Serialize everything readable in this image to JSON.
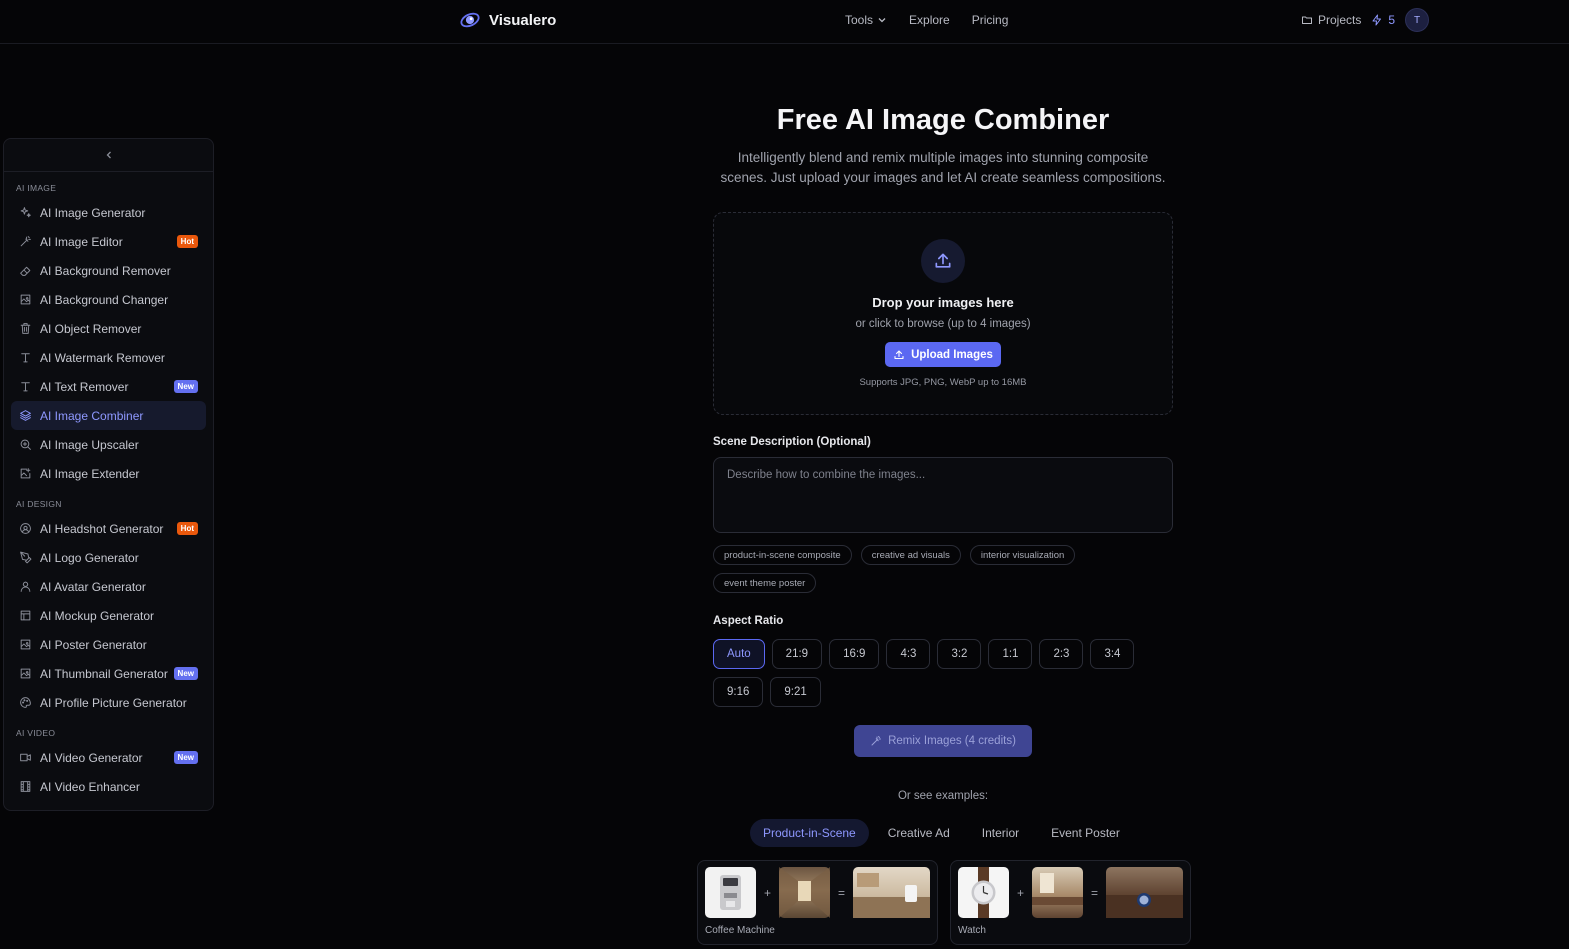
{
  "header": {
    "brand": "Visualero",
    "nav": [
      {
        "label": "Tools",
        "has_dropdown": true
      },
      {
        "label": "Explore"
      },
      {
        "label": "Pricing"
      }
    ],
    "projects_label": "Projects",
    "credits": "5",
    "avatar_initial": "T"
  },
  "sidebar": {
    "sections": [
      {
        "label": "AI IMAGE",
        "items": [
          {
            "label": "AI Image Generator",
            "icon": "sparkles-icon"
          },
          {
            "label": "AI Image Editor",
            "icon": "magic-wand-icon",
            "badge": "Hot"
          },
          {
            "label": "AI Background Remover",
            "icon": "eraser-icon"
          },
          {
            "label": "AI Background Changer",
            "icon": "image-icon"
          },
          {
            "label": "AI Object Remover",
            "icon": "trash-icon"
          },
          {
            "label": "AI Watermark Remover",
            "icon": "text-icon"
          },
          {
            "label": "AI Text Remover",
            "icon": "text-icon",
            "badge": "New"
          },
          {
            "label": "AI Image Combiner",
            "icon": "layers-icon",
            "active": true
          },
          {
            "label": "AI Image Upscaler",
            "icon": "zoom-in-icon"
          },
          {
            "label": "AI Image Extender",
            "icon": "image-plus-icon"
          }
        ]
      },
      {
        "label": "AI DESIGN",
        "items": [
          {
            "label": "AI Headshot Generator",
            "icon": "user-circle-icon",
            "badge": "Hot"
          },
          {
            "label": "AI Logo Generator",
            "icon": "pen-tool-icon"
          },
          {
            "label": "AI Avatar Generator",
            "icon": "user-icon"
          },
          {
            "label": "AI Mockup Generator",
            "icon": "layout-icon"
          },
          {
            "label": "AI Poster Generator",
            "icon": "image-icon"
          },
          {
            "label": "AI Thumbnail Generator",
            "icon": "image-icon",
            "badge": "New"
          },
          {
            "label": "AI Profile Picture Generator",
            "icon": "palette-icon"
          }
        ]
      },
      {
        "label": "AI VIDEO",
        "items": [
          {
            "label": "AI Video Generator",
            "icon": "video-icon",
            "badge": "New"
          },
          {
            "label": "AI Video Enhancer",
            "icon": "film-icon"
          }
        ]
      }
    ]
  },
  "main": {
    "title": "Free AI Image Combiner",
    "subtitle": "Intelligently blend and remix multiple images into stunning composite scenes. Just upload your images and let AI create seamless compositions.",
    "dropzone": {
      "title": "Drop your images here",
      "subtitle": "or click to browse (up to 4 images)",
      "button": "Upload Images",
      "note": "Supports JPG, PNG, WebP up to 16MB"
    },
    "scene_label": "Scene Description (Optional)",
    "scene_placeholder": "Describe how to combine the images...",
    "chips": [
      "product-in-scene composite",
      "creative ad visuals",
      "interior visualization",
      "event theme poster"
    ],
    "aspect_label": "Aspect Ratio",
    "aspect_ratios": [
      "Auto",
      "21:9",
      "16:9",
      "4:3",
      "3:2",
      "1:1",
      "2:3",
      "3:4",
      "9:16",
      "9:21"
    ],
    "aspect_selected": "Auto",
    "remix_button": "Remix Images (4 credits)",
    "examples_label": "Or see examples:",
    "example_tabs": [
      "Product-in-Scene",
      "Creative Ad",
      "Interior",
      "Event Poster"
    ],
    "example_tab_selected": "Product-in-Scene",
    "examples": [
      {
        "label": "Coffee Machine",
        "plus": "+",
        "equals": "="
      },
      {
        "label": "Watch",
        "plus": "+",
        "equals": "="
      }
    ]
  },
  "colors": {
    "accent": "#5b68f2",
    "accent_text": "#8e98ff",
    "hot_badge": "#ea580c",
    "new_badge": "#6470f0",
    "background": "#050507"
  }
}
